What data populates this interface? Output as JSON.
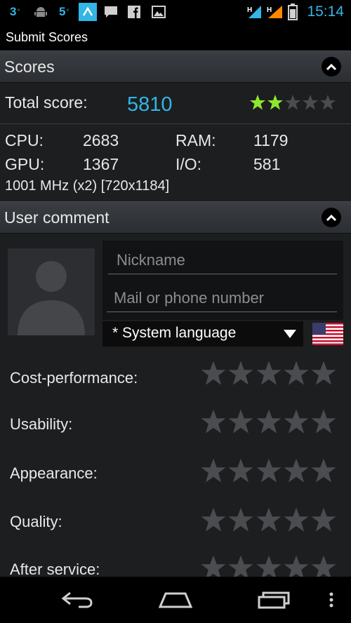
{
  "status_bar": {
    "notif_count_1": "3",
    "notif_count_1_sup": "°",
    "notif_count_2": "5",
    "notif_count_2_sup": "°",
    "network_1": "H",
    "network_2": "H",
    "time": "15:14"
  },
  "action_bar": {
    "title": "Submit Scores"
  },
  "scores": {
    "header": "Scores",
    "total_label": "Total score:",
    "total_value": "5810",
    "stars_filled": 2,
    "stars_total": 5,
    "cpu_label": "CPU:",
    "cpu_value": "2683",
    "ram_label": "RAM:",
    "ram_value": "1179",
    "gpu_label": "GPU:",
    "gpu_value": "1367",
    "io_label": "I/O:",
    "io_value": "581",
    "device_info": "1001 MHz (x2) [720x1184]"
  },
  "user_comment": {
    "header": "User comment",
    "nickname_placeholder": "Nickname",
    "contact_placeholder": "Mail or phone number",
    "language_value": "* System language",
    "ratings": [
      {
        "label": "Cost-performance:"
      },
      {
        "label": "Usability:"
      },
      {
        "label": "Appearance:"
      },
      {
        "label": "Quality:"
      },
      {
        "label": "After service:"
      }
    ]
  },
  "colors": {
    "accent": "#33b5e5",
    "star_filled": "#8ee62d",
    "star_empty": "#4a4c4f"
  }
}
